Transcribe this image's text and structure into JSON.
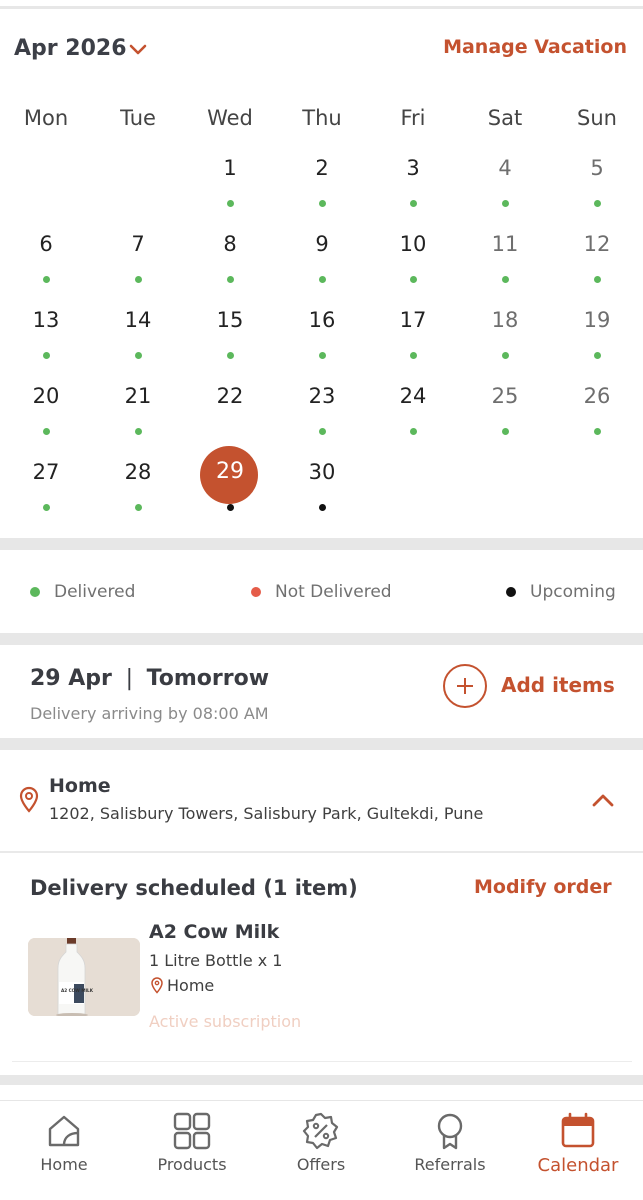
{
  "header": {
    "month": "Apr 2026",
    "manage_vacation": "Manage Vacation"
  },
  "calendar": {
    "weekdays": [
      "Mon",
      "Tue",
      "Wed",
      "Thu",
      "Fri",
      "Sat",
      "Sun"
    ],
    "selected_day": "29",
    "days": [
      {
        "n": "1",
        "status": "delivered"
      },
      {
        "n": "2",
        "status": "delivered"
      },
      {
        "n": "3",
        "status": "delivered"
      },
      {
        "n": "4",
        "status": "delivered"
      },
      {
        "n": "5",
        "status": "delivered"
      },
      {
        "n": "6",
        "status": "delivered"
      },
      {
        "n": "7",
        "status": "delivered"
      },
      {
        "n": "8",
        "status": "delivered"
      },
      {
        "n": "9",
        "status": "delivered"
      },
      {
        "n": "10",
        "status": "delivered"
      },
      {
        "n": "11",
        "status": "delivered"
      },
      {
        "n": "12",
        "status": "delivered"
      },
      {
        "n": "13",
        "status": "delivered"
      },
      {
        "n": "14",
        "status": "delivered"
      },
      {
        "n": "15",
        "status": "delivered"
      },
      {
        "n": "16",
        "status": "delivered"
      },
      {
        "n": "17",
        "status": "delivered"
      },
      {
        "n": "18",
        "status": "delivered"
      },
      {
        "n": "19",
        "status": "delivered"
      },
      {
        "n": "20",
        "status": "delivered"
      },
      {
        "n": "21",
        "status": "delivered"
      },
      {
        "n": "22",
        "status": "none"
      },
      {
        "n": "23",
        "status": "delivered"
      },
      {
        "n": "24",
        "status": "delivered"
      },
      {
        "n": "25",
        "status": "delivered"
      },
      {
        "n": "26",
        "status": "delivered"
      },
      {
        "n": "27",
        "status": "delivered"
      },
      {
        "n": "28",
        "status": "delivered"
      },
      {
        "n": "29",
        "status": "upcoming"
      },
      {
        "n": "30",
        "status": "upcoming"
      }
    ],
    "first_weekday_index": 2
  },
  "legend": {
    "delivered": "Delivered",
    "not_delivered": "Not Delivered",
    "upcoming": "Upcoming"
  },
  "colors": {
    "accent": "#c4522f",
    "delivered": "#5cb85c",
    "not_delivered": "#e55c49",
    "upcoming": "#111111"
  },
  "delivery": {
    "date": "29 Apr",
    "separator": "|",
    "relative": "Tomorrow",
    "arrival": "Delivery arriving by 08:00 AM",
    "add_items": "Add items"
  },
  "address": {
    "label": "Home",
    "line": "1202, Salisbury Towers, Salisbury Park, Gultekdi, Pune"
  },
  "scheduled": {
    "title": "Delivery scheduled (1 item)",
    "modify": "Modify order",
    "item": {
      "name": "A2 Cow Milk",
      "quantity": "1 Litre Bottle x 1",
      "location": "Home",
      "status": "Active subscription",
      "bottle_label": "A2 COW MILK"
    }
  },
  "nav": {
    "home": "Home",
    "products": "Products",
    "offers": "Offers",
    "referrals": "Referrals",
    "calendar": "Calendar",
    "active": "calendar"
  }
}
